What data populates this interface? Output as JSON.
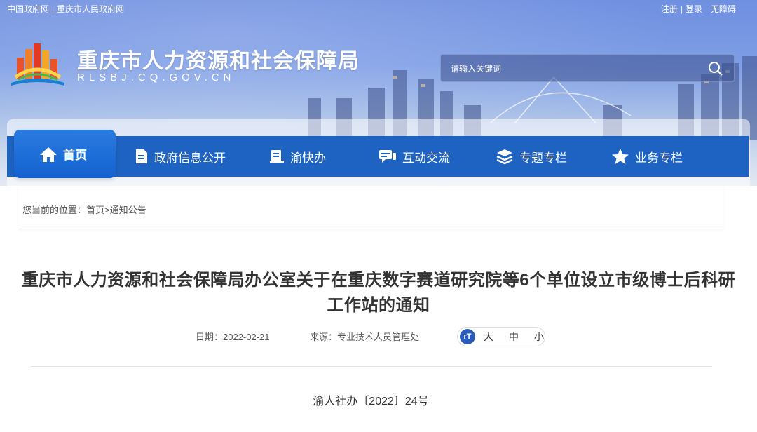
{
  "topbar": {
    "links_left": [
      "中国政府网",
      "重庆市人民政府网"
    ],
    "separator": "|",
    "links_right": [
      "注册",
      "登录",
      "无障碍"
    ]
  },
  "header": {
    "site_title": "重庆市人力资源和社会保障局",
    "domain": "RLSBJ.CQ.GOV.CN",
    "search_placeholder": "请输入关键词"
  },
  "nav": {
    "items": [
      {
        "label": "首页",
        "icon": "home-icon",
        "active": true
      },
      {
        "label": "政府信息公开",
        "icon": "document-icon"
      },
      {
        "label": "渝快办",
        "icon": "book-icon"
      },
      {
        "label": "互动交流",
        "icon": "chat-icon"
      },
      {
        "label": "专题专栏",
        "icon": "layers-icon"
      },
      {
        "label": "业务专栏",
        "icon": "star-icon"
      }
    ]
  },
  "breadcrumb": {
    "prefix": "您当前的位置：",
    "home": "首页",
    "sep": ">",
    "current": "通知公告"
  },
  "article": {
    "title": "重庆市人力资源和社会保障局办公室关于在重庆数字赛道研究院等6个单位设立市级博士后科研工作站的通知",
    "date_label": "日期：",
    "date": "2022-02-21",
    "source_label": "来源：",
    "source": "专业技术人员管理处",
    "font_size": {
      "icon_text": "rT",
      "large": "大",
      "medium": "中",
      "small": "小"
    },
    "doc_number": "渝人社办〔2022〕24号"
  },
  "colors": {
    "nav_bg": "#1e63c2",
    "nav_active": "#1362d0",
    "accent": "#2b5db8"
  }
}
